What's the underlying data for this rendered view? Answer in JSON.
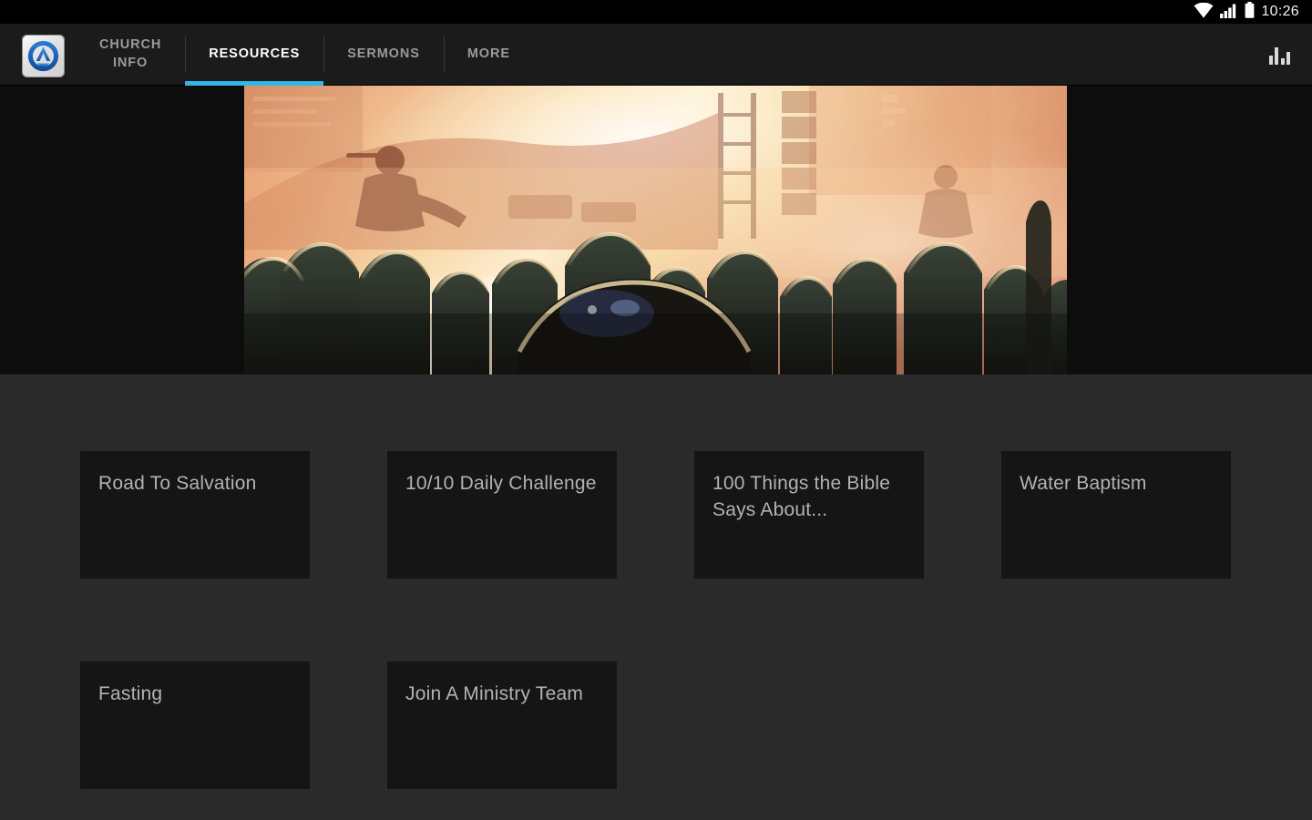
{
  "status_bar": {
    "time": "10:26",
    "icons": [
      "wifi-icon",
      "cellular-signal-icon",
      "battery-icon"
    ]
  },
  "action_bar": {
    "logo": {
      "icon": "church-app-logo-icon",
      "alt": "A"
    },
    "tabs": [
      {
        "label": "CHURCH\nINFO",
        "line1": "CHURCH",
        "line2": "INFO",
        "active": false
      },
      {
        "label": "RESOURCES",
        "line1": "RESOURCES",
        "line2": "",
        "active": true
      },
      {
        "label": "SERMONS",
        "line1": "SERMONS",
        "line2": "",
        "active": false
      },
      {
        "label": "MORE",
        "line1": "MORE",
        "line2": "",
        "active": false
      }
    ],
    "right_action": {
      "icon": "bar-chart-icon"
    }
  },
  "hero": {
    "alt": "Worship concert crowd silhouettes with bright stage lights"
  },
  "resources": {
    "tiles": [
      {
        "title": "Road To Salvation"
      },
      {
        "title": "10/10 Daily Challenge"
      },
      {
        "title": "100 Things the Bible Says About..."
      },
      {
        "title": "Water Baptism"
      },
      {
        "title": "Fasting"
      },
      {
        "title": "Join A Ministry Team"
      }
    ]
  },
  "colors": {
    "accent": "#33b5e5",
    "action_bar_bg": "#1b1b1b",
    "content_bg": "#2a2a2a",
    "hero_band_bg": "#0d0d0d",
    "tile_bg": "#151515",
    "tile_text": "#b2b2b2",
    "tab_inactive_text": "#9a9a9a",
    "tab_active_text": "#ffffff"
  }
}
